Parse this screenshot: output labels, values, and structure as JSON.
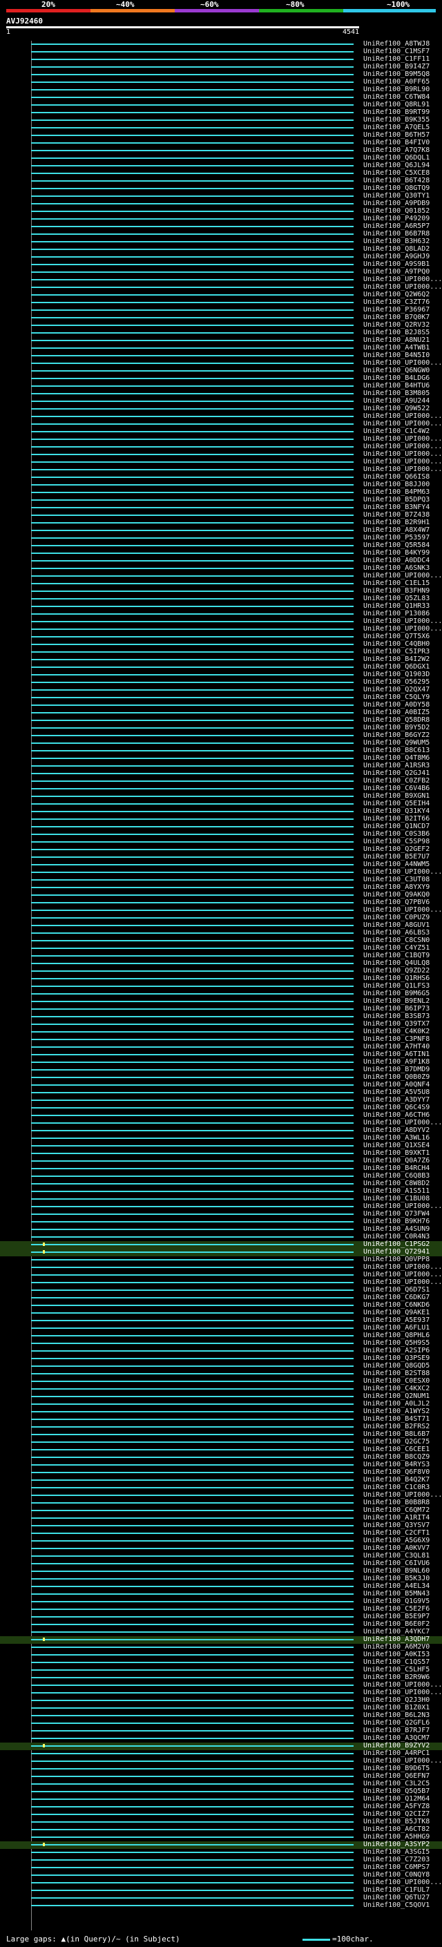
{
  "scale": {
    "labels": [
      "20%",
      "~40%",
      "~60%",
      "~80%",
      "~100%"
    ],
    "colors": [
      "#e02020",
      "#f07820",
      "#9a3ad0",
      "#20b020",
      "#30c8e8"
    ]
  },
  "query": {
    "id": "AVJ92460",
    "start": "1",
    "end": "4541"
  },
  "hits": [
    "UniRef100_A8TWJ8",
    "UniRef100_C1MSF7",
    "UniRef100_C1FF11",
    "UniRef100_B9I4Z7",
    "UniRef100_B9M5Q8",
    "UniRef100_A0FF65",
    "UniRef100_B9RL90",
    "UniRef100_C6TW84",
    "UniRef100_Q8RL91",
    "UniRef100_B9RT99",
    "UniRef100_B9K355",
    "UniRef100_A7QEL5",
    "UniRef100_B6TH57",
    "UniRef100_B4FIV0",
    "UniRef100_A7Q7K8",
    "UniRef100_Q6DQL1",
    "UniRef100_Q6JL94",
    "UniRef100_C5XCE8",
    "UniRef100_B6T428",
    "UniRef100_Q8GTQ9",
    "UniRef100_Q30TY1",
    "UniRef100_A9PDB9",
    "UniRef100_Q01852",
    "UniRef100_P49209",
    "UniRef100_A6R5P7",
    "UniRef100_B6B7R8",
    "UniRef100_B3H632",
    "UniRef100_Q8LAD2",
    "UniRef100_A9GHJ9",
    "UniRef100_A9S9B1",
    "UniRef100_A9TPQ0",
    "UniRef100_UPI000...",
    "UniRef100_UPI000...",
    "UniRef100_Q2W6Q2",
    "UniRef100_C3ZT76",
    "UniRef100_P36967",
    "UniRef100_B7Q0K7",
    "UniRef100_Q2RV32",
    "UniRef100_B2J8S5",
    "UniRef100_A8NU21",
    "UniRef100_A4TWB1",
    "UniRef100_B4N5I0",
    "UniRef100_UPI000...",
    "UniRef100_Q6NGW0",
    "UniRef100_B4LDG6",
    "UniRef100_B4HTU6",
    "UniRef100_B3M805",
    "UniRef100_A9U244",
    "UniRef100_Q9W522",
    "UniRef100_UPI000...",
    "UniRef100_UPI000...",
    "UniRef100_C1C4W2",
    "UniRef100_UPI000...",
    "UniRef100_UPI000...",
    "UniRef100_UPI000...",
    "UniRef100_UPI000...",
    "UniRef100_UPI000...",
    "UniRef100_Q66IS8",
    "UniRef100_B8JJ00",
    "UniRef100_B4PM63",
    "UniRef100_B5DPQ3",
    "UniRef100_B3NFY4",
    "UniRef100_B7Z438",
    "UniRef100_B2R9H1",
    "UniRef100_A8X4W7",
    "UniRef100_P53597",
    "UniRef100_Q5R584",
    "UniRef100_B4KY99",
    "UniRef100_A0DDC4",
    "UniRef100_A6SNK3",
    "UniRef100_UPI000...",
    "UniRef100_C1EL15",
    "UniRef100_B3FHN9",
    "UniRef100_Q5ZL83",
    "UniRef100_Q1HR33",
    "UniRef100_P13086",
    "UniRef100_UPI000...",
    "UniRef100_UPI000...",
    "UniRef100_Q7T5X6",
    "UniRef100_C4QBH0",
    "UniRef100_C5IPR3",
    "UniRef100_B4I2W2",
    "UniRef100_Q6DGX1",
    "UniRef100_Q1903D",
    "UniRef100_O56295",
    "UniRef100_Q2QX47",
    "UniRef100_C5QLY9",
    "UniRef100_A0DY58",
    "UniRef100_A0BIZ5",
    "UniRef100_Q58DR8",
    "UniRef100_B9Y5D2",
    "UniRef100_B6GYZ2",
    "UniRef100_Q9WUM5",
    "UniRef100_B8C613",
    "UniRef100_Q4T8M6",
    "UniRef100_A1RSR3",
    "UniRef100_Q2GJ41",
    "UniRef100_C0ZFB2",
    "UniRef100_C6V4B6",
    "UniRef100_B9XGN1",
    "UniRef100_Q5EIH4",
    "UniRef100_Q31KY4",
    "UniRef100_B2IT66",
    "UniRef100_Q1NCD7",
    "UniRef100_C0S3B6",
    "UniRef100_C5SP98",
    "UniRef100_Q2GEF2",
    "UniRef100_B5E7U7",
    "UniRef100_A4NWM5",
    "UniRef100_UPI000...",
    "UniRef100_C3UT08",
    "UniRef100_A8YXY9",
    "UniRef100_Q9AKQ0",
    "UniRef100_Q7PBV6",
    "UniRef100_UPI000...",
    "UniRef100_C0PUZ9",
    "UniRef100_A8GUV1",
    "UniRef100_A6LBS3",
    "UniRef100_C8CSN0",
    "UniRef100_C4YZ51",
    "UniRef100_C1BQT9",
    "UniRef100_Q4ULQ8",
    "UniRef100_Q9ZD22",
    "UniRef100_Q1RHS6",
    "UniRef100_Q1LFS3",
    "UniRef100_B9M6G5",
    "UniRef100_B9ENL2",
    "UniRef100_B6IP73",
    "UniRef100_B3SB73",
    "UniRef100_Q39TX7",
    "UniRef100_C4K0K2",
    "UniRef100_C3PNF8",
    "UniRef100_A7HT40",
    "UniRef100_A6TIN1",
    "UniRef100_A9F1K8",
    "UniRef100_B7DMD9",
    "UniRef100_Q0B0Z9",
    "UniRef100_A0QNF4",
    "UniRef100_A5V5U8",
    "UniRef100_A3DYY7",
    "UniRef100_Q6C4S9",
    "UniRef100_A6CTH6",
    "UniRef100_UPI000...",
    "UniRef100_A8DYV2",
    "UniRef100_A3WL16",
    "UniRef100_Q1XSE4",
    "UniRef100_B9XKT1",
    "UniRef100_Q0A7Z6",
    "UniRef100_B4RCH4",
    "UniRef100_C6Q8B3",
    "UniRef100_C8W8D2",
    "UniRef100_A1S511",
    "UniRef100_C1BU08",
    "UniRef100_UPI000...",
    "UniRef100_Q73FW4",
    "UniRef100_B9KH76",
    "UniRef100_A4SUN9",
    "UniRef100_C0R4N3",
    "UniRef100_C1PSG2",
    "UniRef100_Q72941",
    "UniRef100_Q0VPP8",
    "UniRef100_UPI000...",
    "UniRef100_UPI000...",
    "UniRef100_UPI000...",
    "UniRef100_Q6D7S1",
    "UniRef100_C6DKG7",
    "UniRef100_C6NKD6",
    "UniRef100_Q9AKE1",
    "UniRef100_A5E937",
    "UniRef100_A6FLU1",
    "UniRef100_Q8PHL6",
    "UniRef100_Q5H9S5",
    "UniRef100_A2SIP6",
    "UniRef100_Q3PSE9",
    "UniRef100_Q8GQD5",
    "UniRef100_B2ST88",
    "UniRef100_C0ESX0",
    "UniRef100_C4KXC2",
    "UniRef100_Q2NUM1",
    "UniRef100_A0LJL2",
    "UniRef100_A1WYS2",
    "UniRef100_B4ST71",
    "UniRef100_B2FRS2",
    "UniRef100_B8L6B7",
    "UniRef100_Q2GC75",
    "UniRef100_C6CEE1",
    "UniRef100_B8CQZ9",
    "UniRef100_B4RYS3",
    "UniRef100_Q6F8V0",
    "UniRef100_B4Q2K7",
    "UniRef100_C1C0R3",
    "UniRef100_UPI000...",
    "UniRef100_B0B8R8",
    "UniRef100_C6QM72",
    "UniRef100_A1RIT4",
    "UniRef100_Q3YSV7",
    "UniRef100_C2CFT1",
    "UniRef100_A5G6X9",
    "UniRef100_A0KVV7",
    "UniRef100_C3QL81",
    "UniRef100_C6IVU6",
    "UniRef100_B9NL60",
    "UniRef100_B5K3J0",
    "UniRef100_A4EL34",
    "UniRef100_B5MN43",
    "UniRef100_Q1G9V5",
    "UniRef100_C5E2F6",
    "UniRef100_B5E9P7",
    "UniRef100_B6E0F2",
    "UniRef100_A4YKC7",
    "UniRef100_A3QDH7",
    "UniRef100_A6M2V0",
    "UniRef100_A0KI53",
    "UniRef100_C1QS57",
    "UniRef100_C5LHF5",
    "UniRef100_B2R9W6",
    "UniRef100_UPI000...",
    "UniRef100_UPI000...",
    "UniRef100_Q2J3H0",
    "UniRef100_B1Z0X1",
    "UniRef100_B6L2N3",
    "UniRef100_Q2GFL6",
    "UniRef100_B7RJF7",
    "UniRef100_A3QCM7",
    "UniRef100_B9ZYV2",
    "UniRef100_A4RPC1",
    "UniRef100_UPI000...",
    "UniRef100_B9D6T5",
    "UniRef100_Q6EFN7",
    "UniRef100_C3L2C5",
    "UniRef100_Q5Q5B7",
    "UniRef100_Q12M64",
    "UniRef100_A5FYZ8",
    "UniRef100_Q2CIZ7",
    "UniRef100_B5JTK8",
    "UniRef100_A6CT82",
    "UniRef100_A5HHG9",
    "UniRef100_A3SYP2",
    "UniRef100_A3SGI5",
    "UniRef100_C7Z203",
    "UniRef100_C6MPS7",
    "UniRef100_C0NQY8",
    "UniRef100_UPI000...",
    "UniRef100_C1FUL7",
    "UniRef100_Q6TU27",
    "UniRef100_C5QOV1"
  ],
  "highlighted_rows": [
    158,
    159,
    210,
    224,
    237
  ],
  "gap_rows": [
    158,
    159,
    210,
    224,
    237
  ],
  "footer": {
    "text": "Large gaps: ▲(in Query)/~ (in Subject)",
    "legend_label": "=100char."
  }
}
